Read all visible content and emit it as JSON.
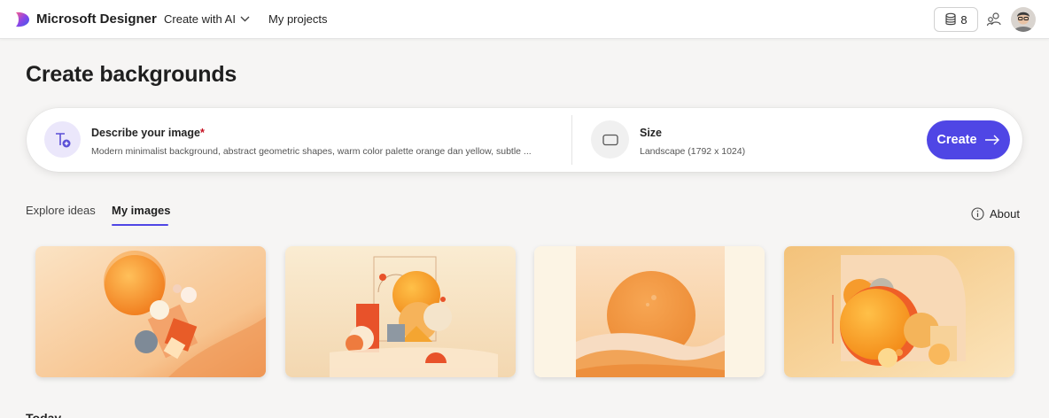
{
  "header": {
    "brand": "Microsoft Designer",
    "nav_create": "Create with AI",
    "nav_projects": "My projects",
    "credits": "8"
  },
  "page": {
    "title": "Create backgrounds"
  },
  "prompt": {
    "describe_label": "Describe your image",
    "describe_required": "*",
    "describe_value": "Modern minimalist background, abstract geometric shapes, warm color palette orange dan yellow, subtle ...",
    "size_label": "Size",
    "size_value": "Landscape (1792 x 1024)",
    "create_label": "Create"
  },
  "tabs": {
    "explore": "Explore ideas",
    "my_images": "My images",
    "about": "About"
  },
  "images": [
    {
      "name": "generated-image-1"
    },
    {
      "name": "generated-image-2"
    },
    {
      "name": "generated-image-3"
    },
    {
      "name": "generated-image-4"
    }
  ],
  "section": {
    "today": "Today"
  },
  "colors": {
    "accent": "#4f46e5",
    "orange": "#f08a2c",
    "cream": "#f7e6c8"
  },
  "icons": [
    "designer-logo-icon",
    "chevron-down-icon",
    "credits-coins-icon",
    "share-people-icon",
    "user-avatar",
    "text-prompt-icon",
    "landscape-size-icon",
    "arrow-right-icon",
    "info-icon"
  ]
}
